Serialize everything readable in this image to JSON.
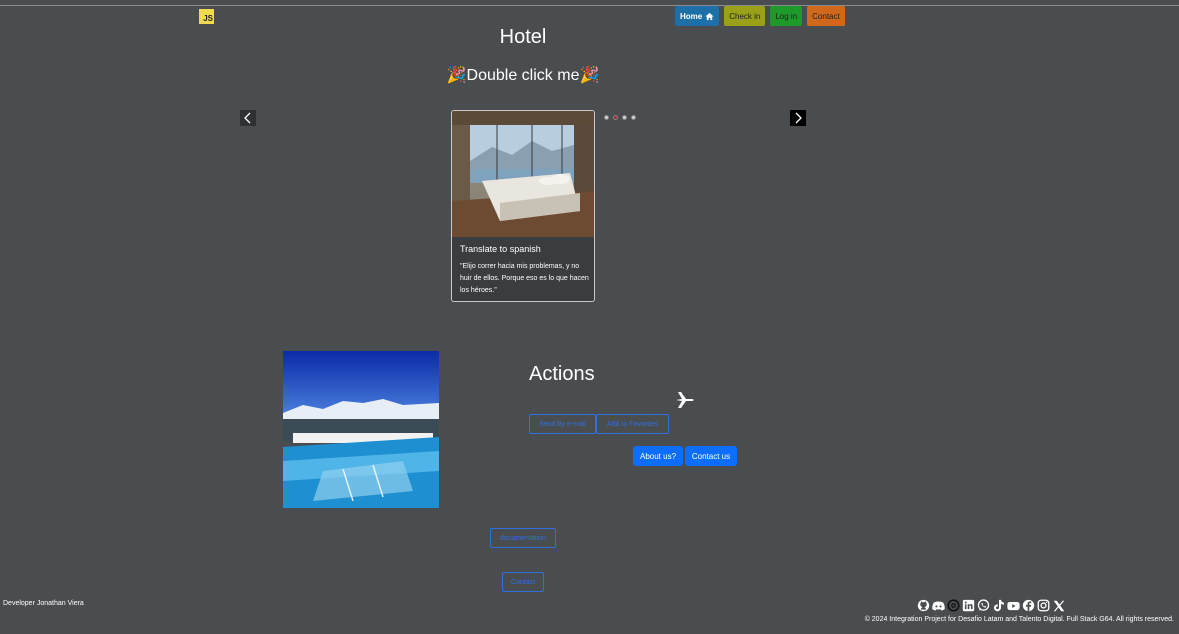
{
  "logo": {
    "text": "JS"
  },
  "nav": {
    "home": "Home",
    "checkin": "Check in",
    "login": "Log in",
    "contact": "Contact"
  },
  "header": {
    "title": "Hotel",
    "subtitle": "Double click me"
  },
  "carousel": {
    "active_index": 1,
    "slide_count": 4,
    "card_title": "Translate to spanish",
    "card_text": "\"Elijo correr hacia mis problemas, y no huir de ellos. Porque eso es lo que hacen los héroes.\""
  },
  "actions": {
    "title": "Actions",
    "send_email": "Send by e-mail",
    "add_favorites": "Add to Favorites",
    "about_us": "About us?",
    "contact_us": "Contact us",
    "documentation": "documentation",
    "contact": "Contact"
  },
  "footer": {
    "developer": "Developer Jonathan Viera",
    "copyright": "© 2024 Integration Project for Desafio Latam and Talento Digital. Full Stack G64. All rights reserved.",
    "socials": [
      "github-icon",
      "discord-icon",
      "threads-icon",
      "linkedin-icon",
      "whatsapp-icon",
      "tiktok-icon",
      "youtube-icon",
      "facebook-icon",
      "instagram-icon",
      "x-icon"
    ]
  }
}
